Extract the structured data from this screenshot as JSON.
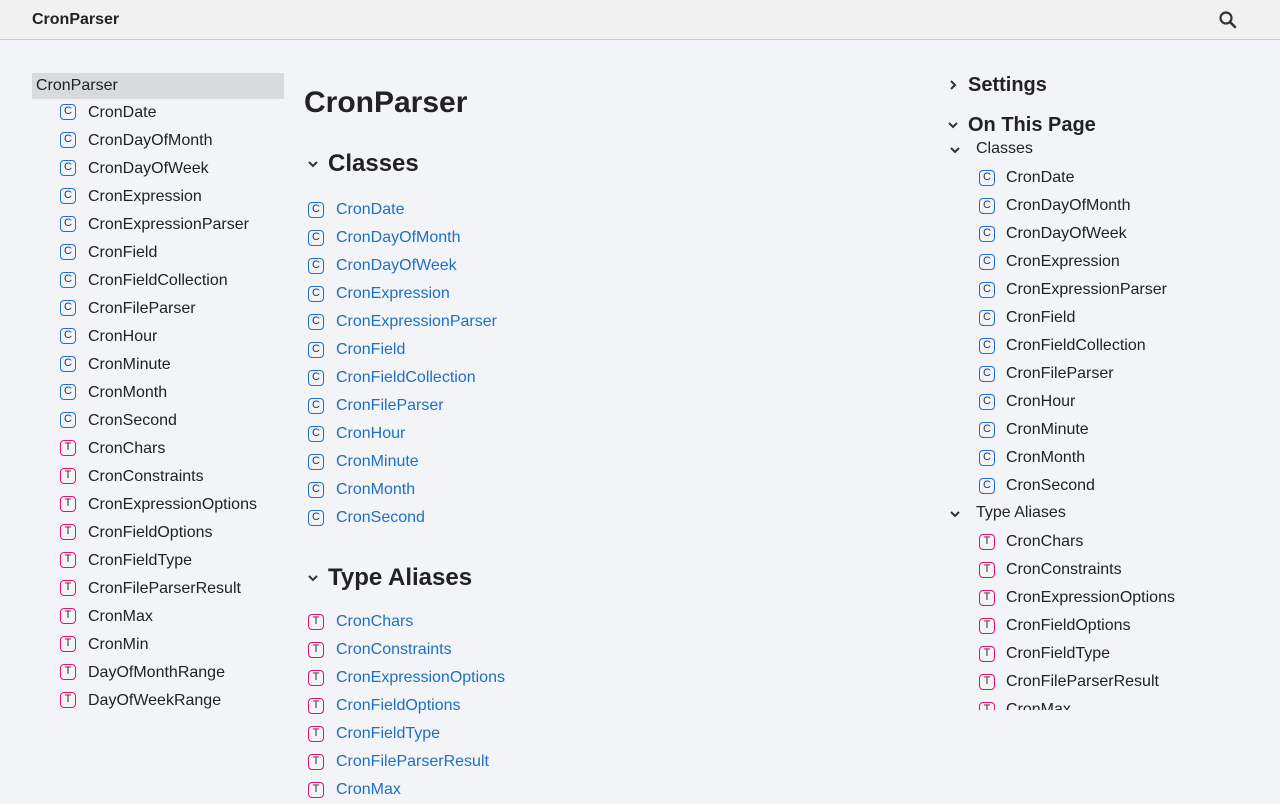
{
  "header": {
    "title": "CronParser",
    "search_icon": "search-icon"
  },
  "nav": {
    "root": "CronParser",
    "items": [
      {
        "kind": "C",
        "label": "CronDate"
      },
      {
        "kind": "C",
        "label": "CronDayOfMonth"
      },
      {
        "kind": "C",
        "label": "CronDayOfWeek"
      },
      {
        "kind": "C",
        "label": "CronExpression"
      },
      {
        "kind": "C",
        "label": "CronExpressionParser"
      },
      {
        "kind": "C",
        "label": "CronField"
      },
      {
        "kind": "C",
        "label": "CronFieldCollection"
      },
      {
        "kind": "C",
        "label": "CronFileParser"
      },
      {
        "kind": "C",
        "label": "CronHour"
      },
      {
        "kind": "C",
        "label": "CronMinute"
      },
      {
        "kind": "C",
        "label": "CronMonth"
      },
      {
        "kind": "C",
        "label": "CronSecond"
      },
      {
        "kind": "T",
        "label": "CronChars"
      },
      {
        "kind": "T",
        "label": "CronConstraints"
      },
      {
        "kind": "T",
        "label": "CronExpressionOptions"
      },
      {
        "kind": "T",
        "label": "CronFieldOptions"
      },
      {
        "kind": "T",
        "label": "CronFieldType"
      },
      {
        "kind": "T",
        "label": "CronFileParserResult"
      },
      {
        "kind": "T",
        "label": "CronMax"
      },
      {
        "kind": "T",
        "label": "CronMin"
      },
      {
        "kind": "T",
        "label": "DayOfMonthRange"
      },
      {
        "kind": "T",
        "label": "DayOfWeekRange"
      }
    ]
  },
  "main": {
    "title": "CronParser",
    "sections": [
      {
        "title": "Classes",
        "kind": "C",
        "items": [
          "CronDate",
          "CronDayOfMonth",
          "CronDayOfWeek",
          "CronExpression",
          "CronExpressionParser",
          "CronField",
          "CronFieldCollection",
          "CronFileParser",
          "CronHour",
          "CronMinute",
          "CronMonth",
          "CronSecond"
        ]
      },
      {
        "title": "Type Aliases",
        "kind": "T",
        "items": [
          "CronChars",
          "CronConstraints",
          "CronExpressionOptions",
          "CronFieldOptions",
          "CronFieldType",
          "CronFileParserResult",
          "CronMax"
        ]
      }
    ]
  },
  "right_panel": {
    "settings": "Settings",
    "on_this_page": "On This Page",
    "groups": [
      {
        "title": "Classes",
        "kind": "C",
        "items": [
          "CronDate",
          "CronDayOfMonth",
          "CronDayOfWeek",
          "CronExpression",
          "CronExpressionParser",
          "CronField",
          "CronFieldCollection",
          "CronFileParser",
          "CronHour",
          "CronMinute",
          "CronMonth",
          "CronSecond"
        ]
      },
      {
        "title": "Type Aliases",
        "kind": "T",
        "items": [
          "CronChars",
          "CronConstraints",
          "CronExpressionOptions",
          "CronFieldOptions",
          "CronFieldType",
          "CronFileParserResult",
          "CronMax"
        ]
      }
    ]
  },
  "colors": {
    "class_kind": "#1f70c2",
    "type_alias_kind": "#db1373",
    "link": "#1f70c2"
  }
}
